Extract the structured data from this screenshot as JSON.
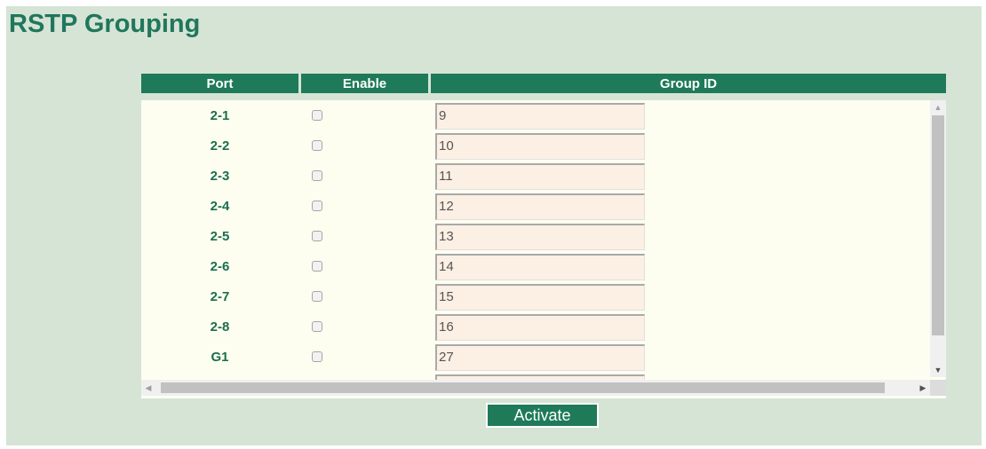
{
  "page": {
    "title": "RSTP Grouping"
  },
  "table": {
    "headers": {
      "port": "Port",
      "enable": "Enable",
      "group_id": "Group ID"
    },
    "rows": [
      {
        "port": "2-1",
        "enabled": false,
        "group_id": "9"
      },
      {
        "port": "2-2",
        "enabled": false,
        "group_id": "10"
      },
      {
        "port": "2-3",
        "enabled": false,
        "group_id": "11"
      },
      {
        "port": "2-4",
        "enabled": false,
        "group_id": "12"
      },
      {
        "port": "2-5",
        "enabled": false,
        "group_id": "13"
      },
      {
        "port": "2-6",
        "enabled": false,
        "group_id": "14"
      },
      {
        "port": "2-7",
        "enabled": false,
        "group_id": "15"
      },
      {
        "port": "2-8",
        "enabled": false,
        "group_id": "16"
      },
      {
        "port": "G1",
        "enabled": false,
        "group_id": "27"
      }
    ]
  },
  "activate_label": "Activate",
  "colors": {
    "accent": "#1f7a59",
    "title": "#20775d",
    "page_bg": "#d6e4d6",
    "input_bg": "#fcf0e4"
  }
}
